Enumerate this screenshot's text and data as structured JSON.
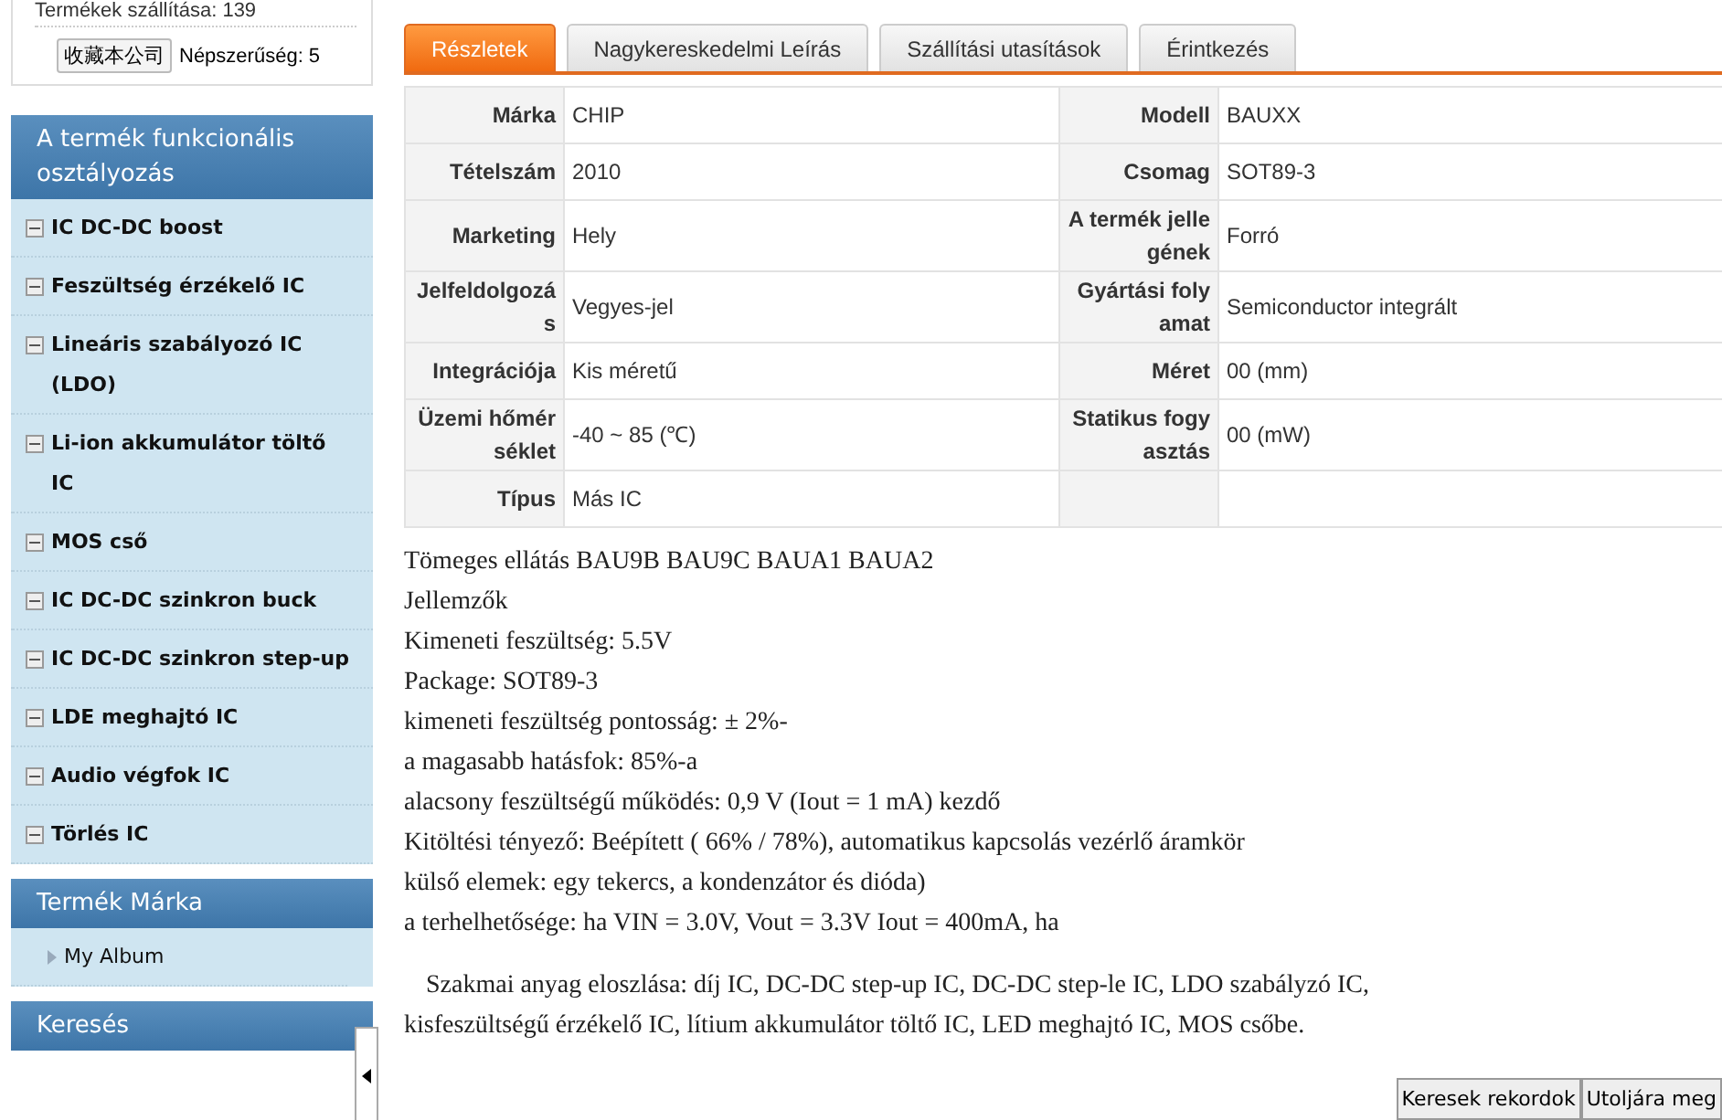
{
  "company_box": {
    "shipped": "Termékek szállítása: 139",
    "favorite_button": "收藏本公司",
    "popularity": "Népszerűség: 5"
  },
  "sidebar": {
    "sections": [
      {
        "title": "A termék funkcionális osztályozás",
        "items": [
          {
            "label": "IC DC-DC boost",
            "kind": "category"
          },
          {
            "label": "Feszültség érzékelő IC",
            "kind": "category"
          },
          {
            "label": "Lineáris szabályozó IC (LDO)",
            "kind": "category"
          },
          {
            "label": "Li-ion akkumulátor töltő IC",
            "kind": "category"
          },
          {
            "label": "MOS cső",
            "kind": "category"
          },
          {
            "label": "IC DC-DC szinkron buck",
            "kind": "category"
          },
          {
            "label": "IC DC-DC szinkron step-up",
            "kind": "category"
          },
          {
            "label": "LDE meghajtó IC",
            "kind": "category"
          },
          {
            "label": "Audio végfok IC",
            "kind": "category"
          },
          {
            "label": "Törlés IC",
            "kind": "category"
          }
        ]
      },
      {
        "title": "Termék Márka",
        "items": [
          {
            "label": "My Album",
            "kind": "album"
          }
        ]
      },
      {
        "title": "Keresés"
      }
    ]
  },
  "tabs": [
    {
      "label": "Részletek",
      "selected": true
    },
    {
      "label": "Nagykereskedelmi Leírás",
      "selected": false
    },
    {
      "label": "Szállítási utasítások",
      "selected": false
    },
    {
      "label": "Érintkezés",
      "selected": false
    }
  ],
  "specs": [
    [
      {
        "label": "Márka",
        "value": "CHIP"
      },
      {
        "label": "Modell",
        "value": "BAUXX"
      }
    ],
    [
      {
        "label": "Tételszám",
        "value": "2010"
      },
      {
        "label": "Csomag",
        "value": "SOT89-3"
      }
    ],
    [
      {
        "label": "Marketing",
        "value": "Hely"
      },
      {
        "label": "A termék jellegének",
        "value": "Forró"
      }
    ],
    [
      {
        "label": "Jelfeldolgozás",
        "value": "Vegyes-jel"
      },
      {
        "label": "Gyártási folyamat",
        "value": "Semiconductor integrált"
      }
    ],
    [
      {
        "label": "Integrációja",
        "value": "Kis méretű"
      },
      {
        "label": "Méret",
        "value": "00 (mm)"
      }
    ],
    [
      {
        "label": "Üzemi hőmérséklet",
        "value": "-40 ~ 85 (℃)"
      },
      {
        "label": "Statikus fogyasztás",
        "value": "00 (mW)"
      }
    ],
    [
      {
        "label": "Típus",
        "value": "Más IC"
      }
    ]
  ],
  "description": {
    "lines": [
      "Tömeges ellátás BAU9B BAU9C BAUA1 BAUA2",
      "Jellemzők",
      "Kimeneti feszültség: 5.5V",
      "Package: SOT89-3",
      "kimeneti feszültség pontosság: ± 2%-",
      "a magasabb hatásfok: 85%-a",
      "alacsony feszültségű működés: 0,9 V (Iout = 1 mA) kezdő",
      "Kitöltési tényező: Beépített ( 66% / 78%), automatikus kapcsolás vezérlő áramkör",
      "külső elemek: egy tekercs, a kondenzátor és dióda)",
      "a terhelhetősége: ha VIN = 3.0V, Vout = 3.3V Iout = 400mA, ha"
    ],
    "paragraph": "Szakmai anyag eloszlása: díj IC, DC-DC step-up IC, DC-DC step-le IC, LDO szabályzó IC, kisfeszültségű érzékelő IC, lítium akkumulátor töltő IC, LED meghajtó IC, MOS csőbe."
  },
  "floating_buttons": [
    "Keresek rekordok",
    "Utoljára meg"
  ]
}
